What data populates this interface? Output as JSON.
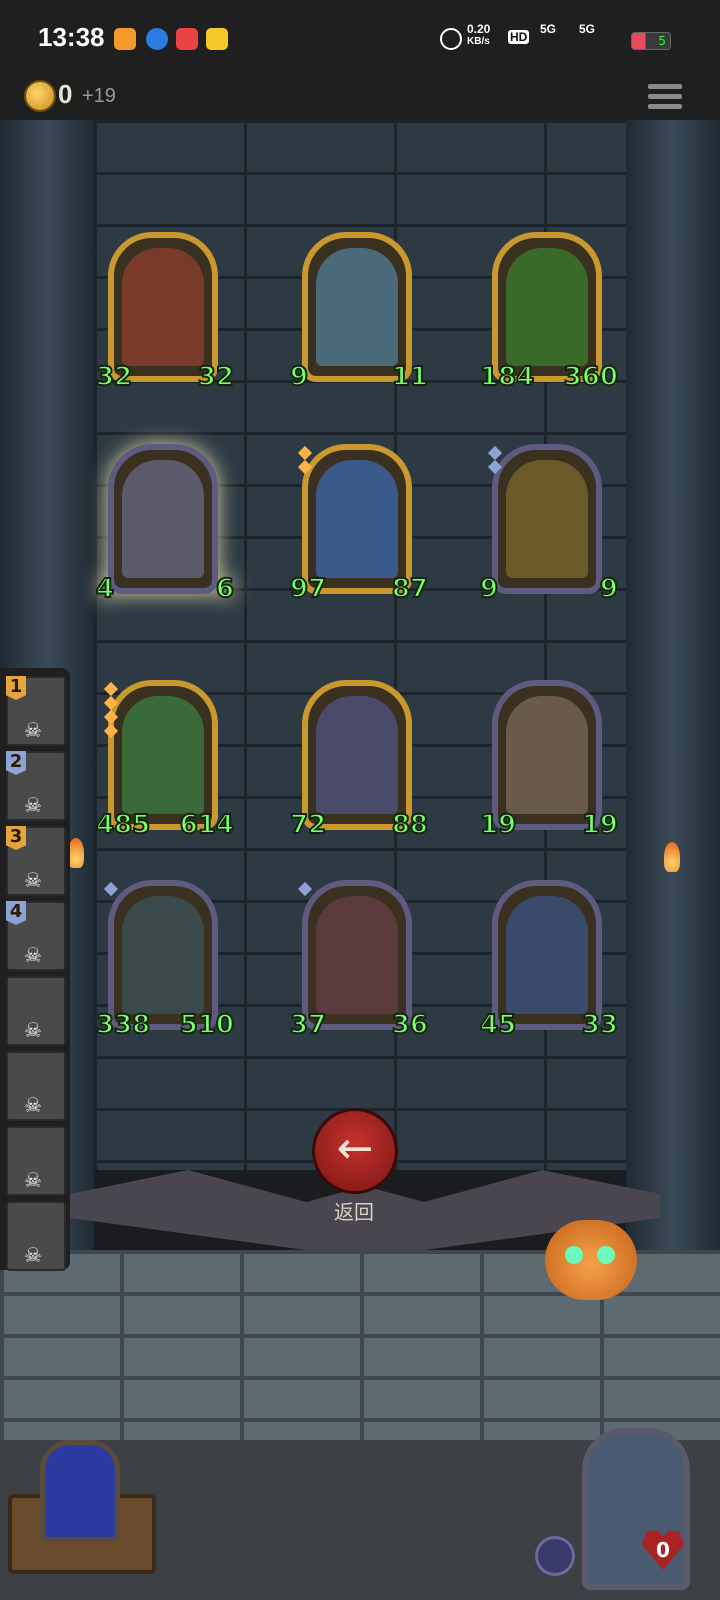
{
  "status_bar": {
    "time": "13:38",
    "net_speed_value": "0.20",
    "net_speed_unit": "KB/s",
    "hd": "HD",
    "signal1": "5G",
    "signal2": "5G",
    "battery": "5"
  },
  "hud": {
    "coins": "0",
    "coin_bonus": "+19",
    "menu_icon": "hamburger-menu-icon"
  },
  "board": {
    "cards": [
      {
        "atk": "32",
        "hp": "32",
        "frame": "gold",
        "gems": 0
      },
      {
        "atk": "9",
        "hp": "11",
        "frame": "gold",
        "gems": 0
      },
      {
        "atk": "184",
        "hp": "360",
        "frame": "gold",
        "gems": 0
      },
      {
        "atk": "4",
        "hp": "6",
        "frame": "silver",
        "gems": 0,
        "highlighted": true
      },
      {
        "atk": "97",
        "hp": "87",
        "frame": "gold",
        "gems": 2
      },
      {
        "atk": "9",
        "hp": "9",
        "frame": "silver",
        "gems": 2
      },
      {
        "atk": "485",
        "hp": "614",
        "frame": "gold",
        "gems": 4
      },
      {
        "atk": "72",
        "hp": "88",
        "frame": "gold",
        "gems": 0
      },
      {
        "atk": "19",
        "hp": "19",
        "frame": "silver",
        "gems": 0
      },
      {
        "atk": "338",
        "hp": "510",
        "frame": "silver",
        "gems": 1
      },
      {
        "atk": "37",
        "hp": "36",
        "frame": "silver",
        "gems": 1
      },
      {
        "atk": "45",
        "hp": "33",
        "frame": "silver",
        "gems": 0
      }
    ]
  },
  "sidebar": {
    "slots": [
      {
        "num": "1",
        "num_color": "gold"
      },
      {
        "num": "2",
        "num_color": "blue"
      },
      {
        "num": "3",
        "num_color": "gold"
      },
      {
        "num": "4",
        "num_color": "blue"
      },
      {
        "num": ""
      },
      {
        "num": ""
      },
      {
        "num": ""
      },
      {
        "num": ""
      }
    ]
  },
  "back_button": {
    "label": "返回",
    "icon": "arrow-left-icon"
  },
  "bottom": {
    "hero_health": "0",
    "shield_icon": "shield-icon",
    "heart_icon": "heart-icon"
  }
}
